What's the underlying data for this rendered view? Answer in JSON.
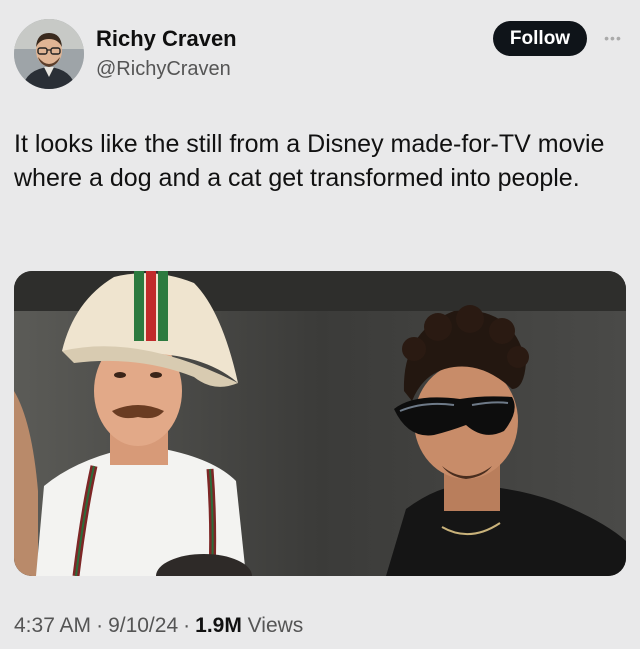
{
  "author": {
    "display_name": "Richy Craven",
    "handle": "@RichyCraven"
  },
  "actions": {
    "follow_label": "Follow",
    "more_icon": "more-dots-icon"
  },
  "tweet": {
    "text": "It looks like the still from a Disney made-for-TV movie where a dog and a cat get transformed into people.",
    "media_icon": "photo"
  },
  "meta": {
    "time": "4:37 AM",
    "date": "9/10/24",
    "views_count": "1.9M",
    "views_label": "Views"
  },
  "colors": {
    "background": "#e9e9ea",
    "follow_button": "#0f1419",
    "secondary_text": "#555555"
  }
}
